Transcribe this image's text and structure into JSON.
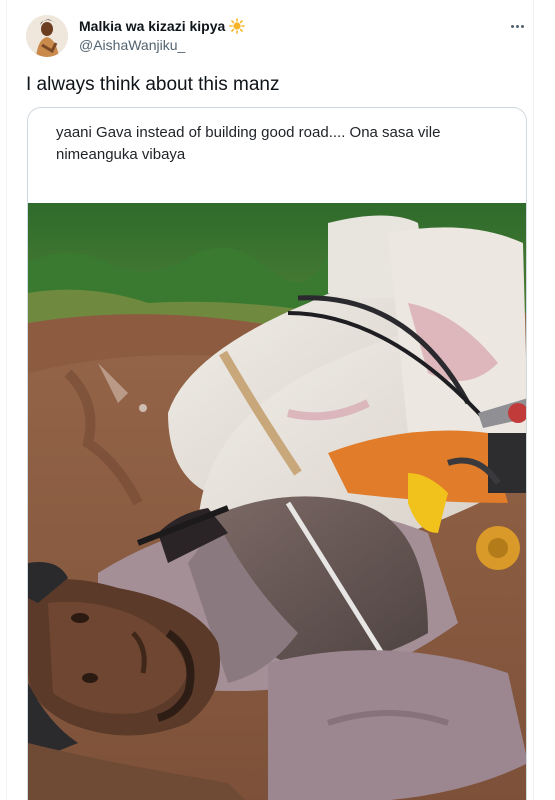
{
  "author": {
    "display_name": "Malkia wa kizazi kipya",
    "handle": "@AishaWanjiku_"
  },
  "tweet": {
    "text": "I always think about this manz"
  },
  "quoted": {
    "text": "yaani Gava instead of building good road.... Ona sasa vile nimeanguka vibaya"
  },
  "icons": {
    "badge": "sun-emoji-icon",
    "more": "more-options-icon"
  },
  "colors": {
    "text_primary": "#0f1419",
    "text_secondary": "#536471",
    "border": "#cfd9de",
    "sun": "#f5b527"
  }
}
